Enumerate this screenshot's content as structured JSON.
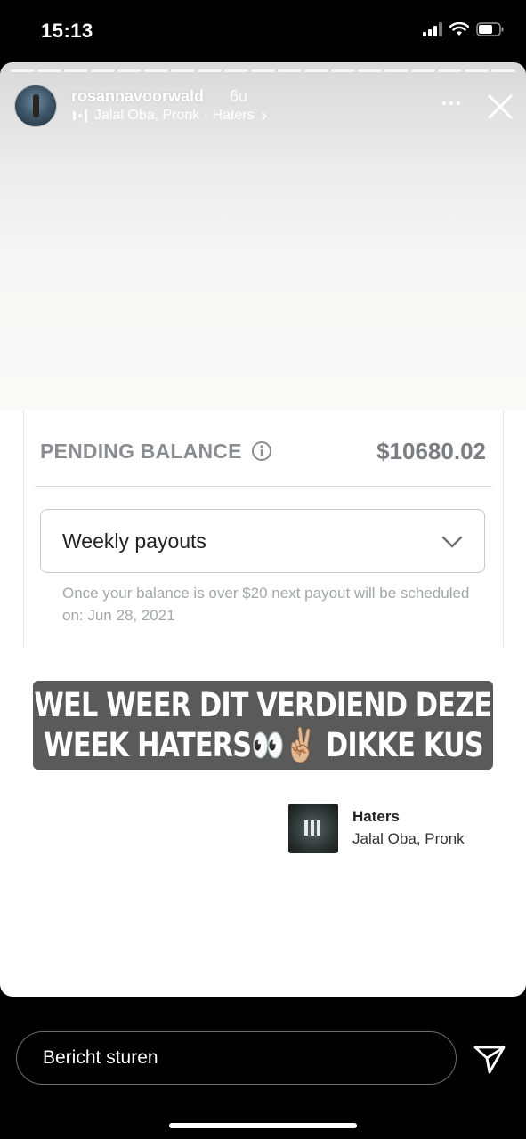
{
  "status_bar": {
    "time": "15:13"
  },
  "story": {
    "progress_segments": 19,
    "username": "rosannavoorwald",
    "time_ago": "6u",
    "music_text": "Jalal Oba, Pronk · Haters",
    "music_chevron": "›"
  },
  "panel": {
    "pending_label": "PENDING BALANCE",
    "pending_amount": "$10680.02",
    "payout_option": "Weekly payouts",
    "payout_note": "Once your balance is over $20 next payout will be scheduled on: Jun 28, 2021"
  },
  "caption": {
    "line1": "WEL WEER DIT VERDIEND DEZE",
    "line2": "WEEK HATERS👀✌🏼 DIKKE KUS"
  },
  "music_sticker": {
    "title": "Haters",
    "artist": "Jalal Oba, Pronk"
  },
  "bottom_bar": {
    "message_placeholder": "Bericht sturen"
  },
  "icons": {
    "signal": "signal-icon",
    "wifi": "wifi-icon",
    "battery": "battery-icon",
    "more": "more-icon",
    "close": "close-icon",
    "info": "info-icon",
    "chevron": "chevron-down-icon",
    "send": "send-icon"
  }
}
